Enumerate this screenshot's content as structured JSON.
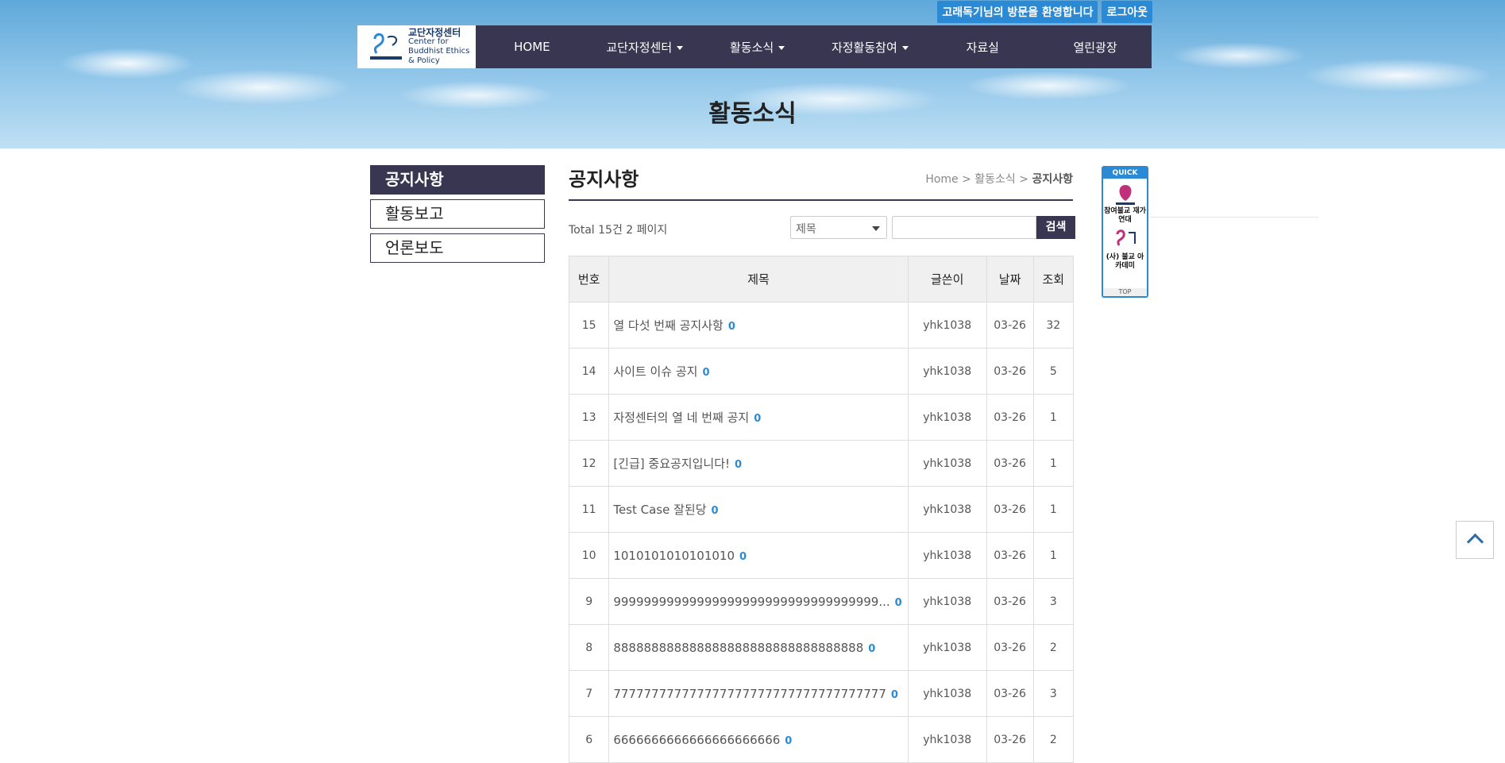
{
  "topbar": {
    "welcome": "고래독기님의 방문을 환영합니다",
    "logout": "로그아웃"
  },
  "logo": {
    "name_ko": "교단자정센터",
    "name_en_1": "Center for",
    "name_en_2": "Buddhist Ethics & Policy"
  },
  "nav": {
    "items": [
      {
        "label": "HOME",
        "has_dropdown": false
      },
      {
        "label": "교단자정센터",
        "has_dropdown": true
      },
      {
        "label": "활동소식",
        "has_dropdown": true
      },
      {
        "label": "자정활동참여",
        "has_dropdown": true
      },
      {
        "label": "자료실",
        "has_dropdown": false
      },
      {
        "label": "열린광장",
        "has_dropdown": false
      }
    ]
  },
  "hero": {
    "title": "활동소식"
  },
  "sidebar": {
    "items": [
      {
        "label": "공지사항",
        "active": true
      },
      {
        "label": "활동보고",
        "active": false
      },
      {
        "label": "언론보도",
        "active": false
      }
    ]
  },
  "main": {
    "title": "공지사항",
    "breadcrumb": {
      "home": "Home",
      "section": "활동소식",
      "current": "공지사항"
    },
    "meta": "Total 15건 2 페이지"
  },
  "search": {
    "select_value": "제목",
    "input_value": "",
    "button": "검색"
  },
  "table": {
    "headers": [
      "번호",
      "제목",
      "글쓴이",
      "날짜",
      "조회"
    ],
    "rows": [
      {
        "no": "15",
        "subject": "열 다섯 번째 공지사항",
        "comments": "0",
        "author": "yhk1038",
        "date": "03-26",
        "views": "32"
      },
      {
        "no": "14",
        "subject": "사이트 이슈 공지",
        "comments": "0",
        "author": "yhk1038",
        "date": "03-26",
        "views": "5"
      },
      {
        "no": "13",
        "subject": "자정센터의 열 네 번째 공지",
        "comments": "0",
        "author": "yhk1038",
        "date": "03-26",
        "views": "1"
      },
      {
        "no": "12",
        "subject": "[긴급] 중요공지입니다!",
        "comments": "0",
        "author": "yhk1038",
        "date": "03-26",
        "views": "1"
      },
      {
        "no": "11",
        "subject": "Test Case 잘된당",
        "comments": "0",
        "author": "yhk1038",
        "date": "03-26",
        "views": "1"
      },
      {
        "no": "10",
        "subject": "1010101010101010",
        "comments": "0",
        "author": "yhk1038",
        "date": "03-26",
        "views": "1"
      },
      {
        "no": "9",
        "subject": "99999999999999999999999999999999999...",
        "comments": "0",
        "author": "yhk1038",
        "date": "03-26",
        "views": "3"
      },
      {
        "no": "8",
        "subject": "888888888888888888888888888888888",
        "comments": "0",
        "author": "yhk1038",
        "date": "03-26",
        "views": "2"
      },
      {
        "no": "7",
        "subject": "777777777777777777777777777777777777",
        "comments": "0",
        "author": "yhk1038",
        "date": "03-26",
        "views": "3"
      },
      {
        "no": "6",
        "subject": "6666666666666666666666",
        "comments": "0",
        "author": "yhk1038",
        "date": "03-26",
        "views": "2"
      }
    ]
  },
  "quick": {
    "header": "QUICK",
    "item1": "참여불교 재가연대",
    "item2": "(사) 불교 아카데미",
    "top": "TOP"
  },
  "colors": {
    "nav_bg": "#393651",
    "accent_blue": "#2c8ad4"
  }
}
